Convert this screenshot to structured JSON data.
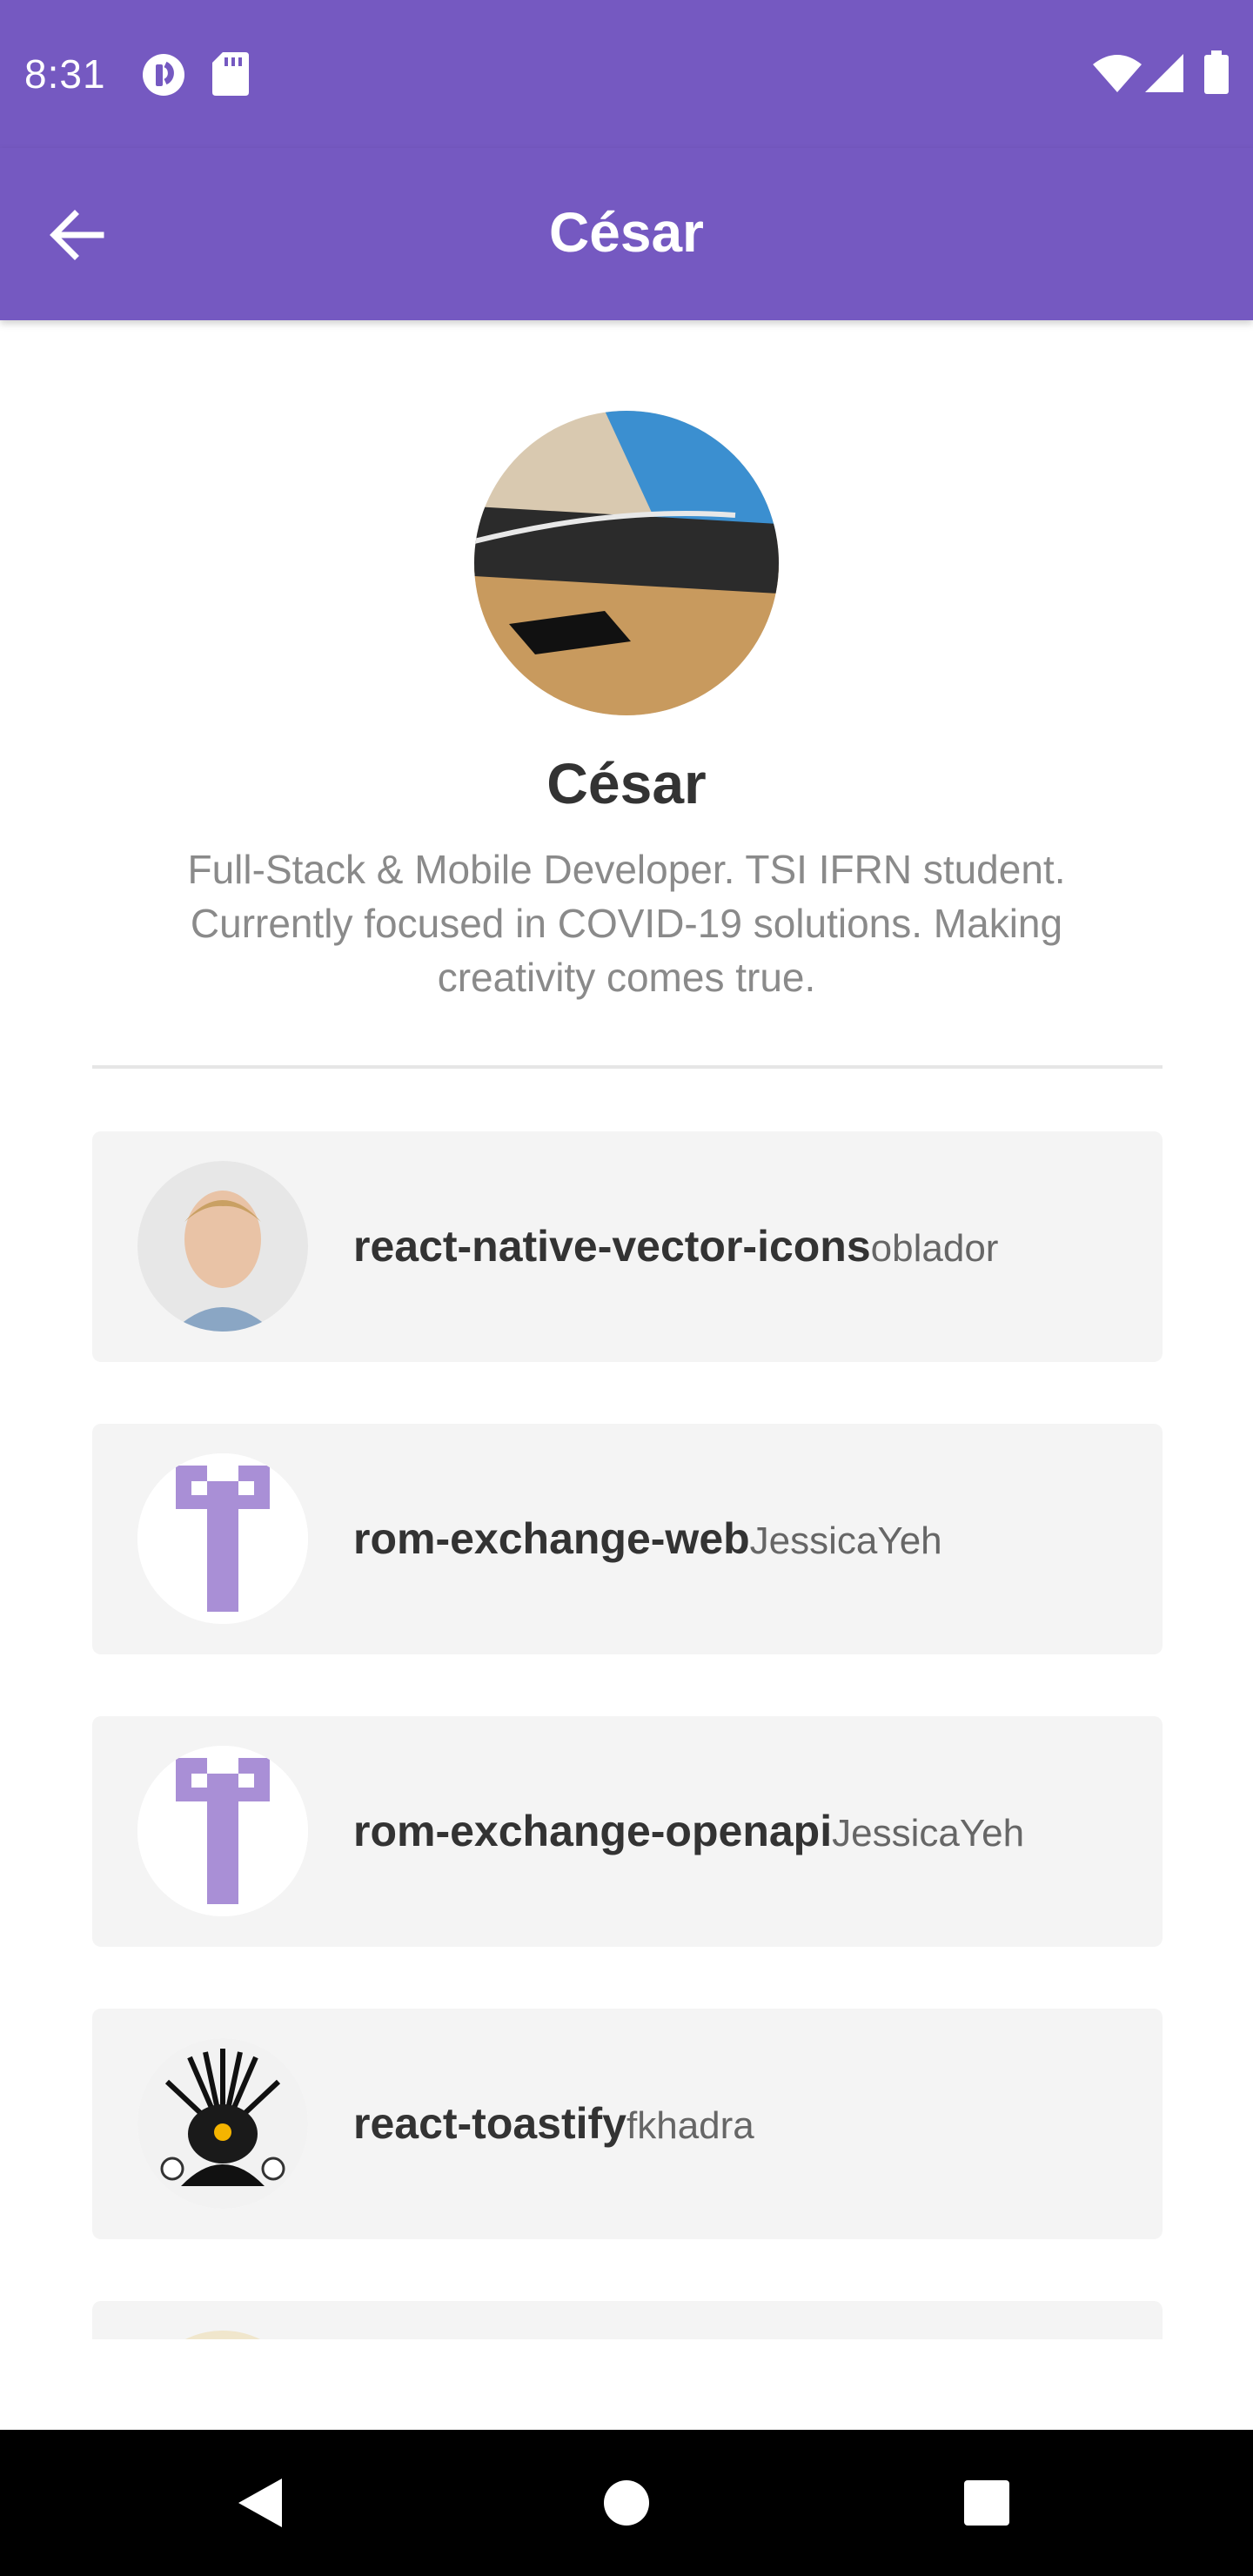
{
  "status_bar": {
    "time": "8:31",
    "icons": [
      "pocket-casts-icon",
      "sd-card-icon",
      "wifi-icon",
      "cell-signal-icon",
      "battery-icon"
    ]
  },
  "app_bar": {
    "title": "César",
    "back_icon": "arrow-left-icon",
    "color": "#7559c1"
  },
  "profile": {
    "name": "César",
    "bio": "Full-Stack & Mobile Developer. TSI IFRN student. Currently focused in COVID-19 solutions. Making creativity comes true."
  },
  "repositories": [
    {
      "name": "react-native-vector-icons",
      "owner": "oblador"
    },
    {
      "name": "rom-exchange-web",
      "owner": "JessicaYeh"
    },
    {
      "name": "rom-exchange-openapi",
      "owner": "JessicaYeh"
    },
    {
      "name": "react-toastify",
      "owner": "fkhadra"
    }
  ],
  "nav_bar": {
    "buttons": [
      "back-triangle-icon",
      "home-circle-icon",
      "recents-square-icon"
    ]
  }
}
